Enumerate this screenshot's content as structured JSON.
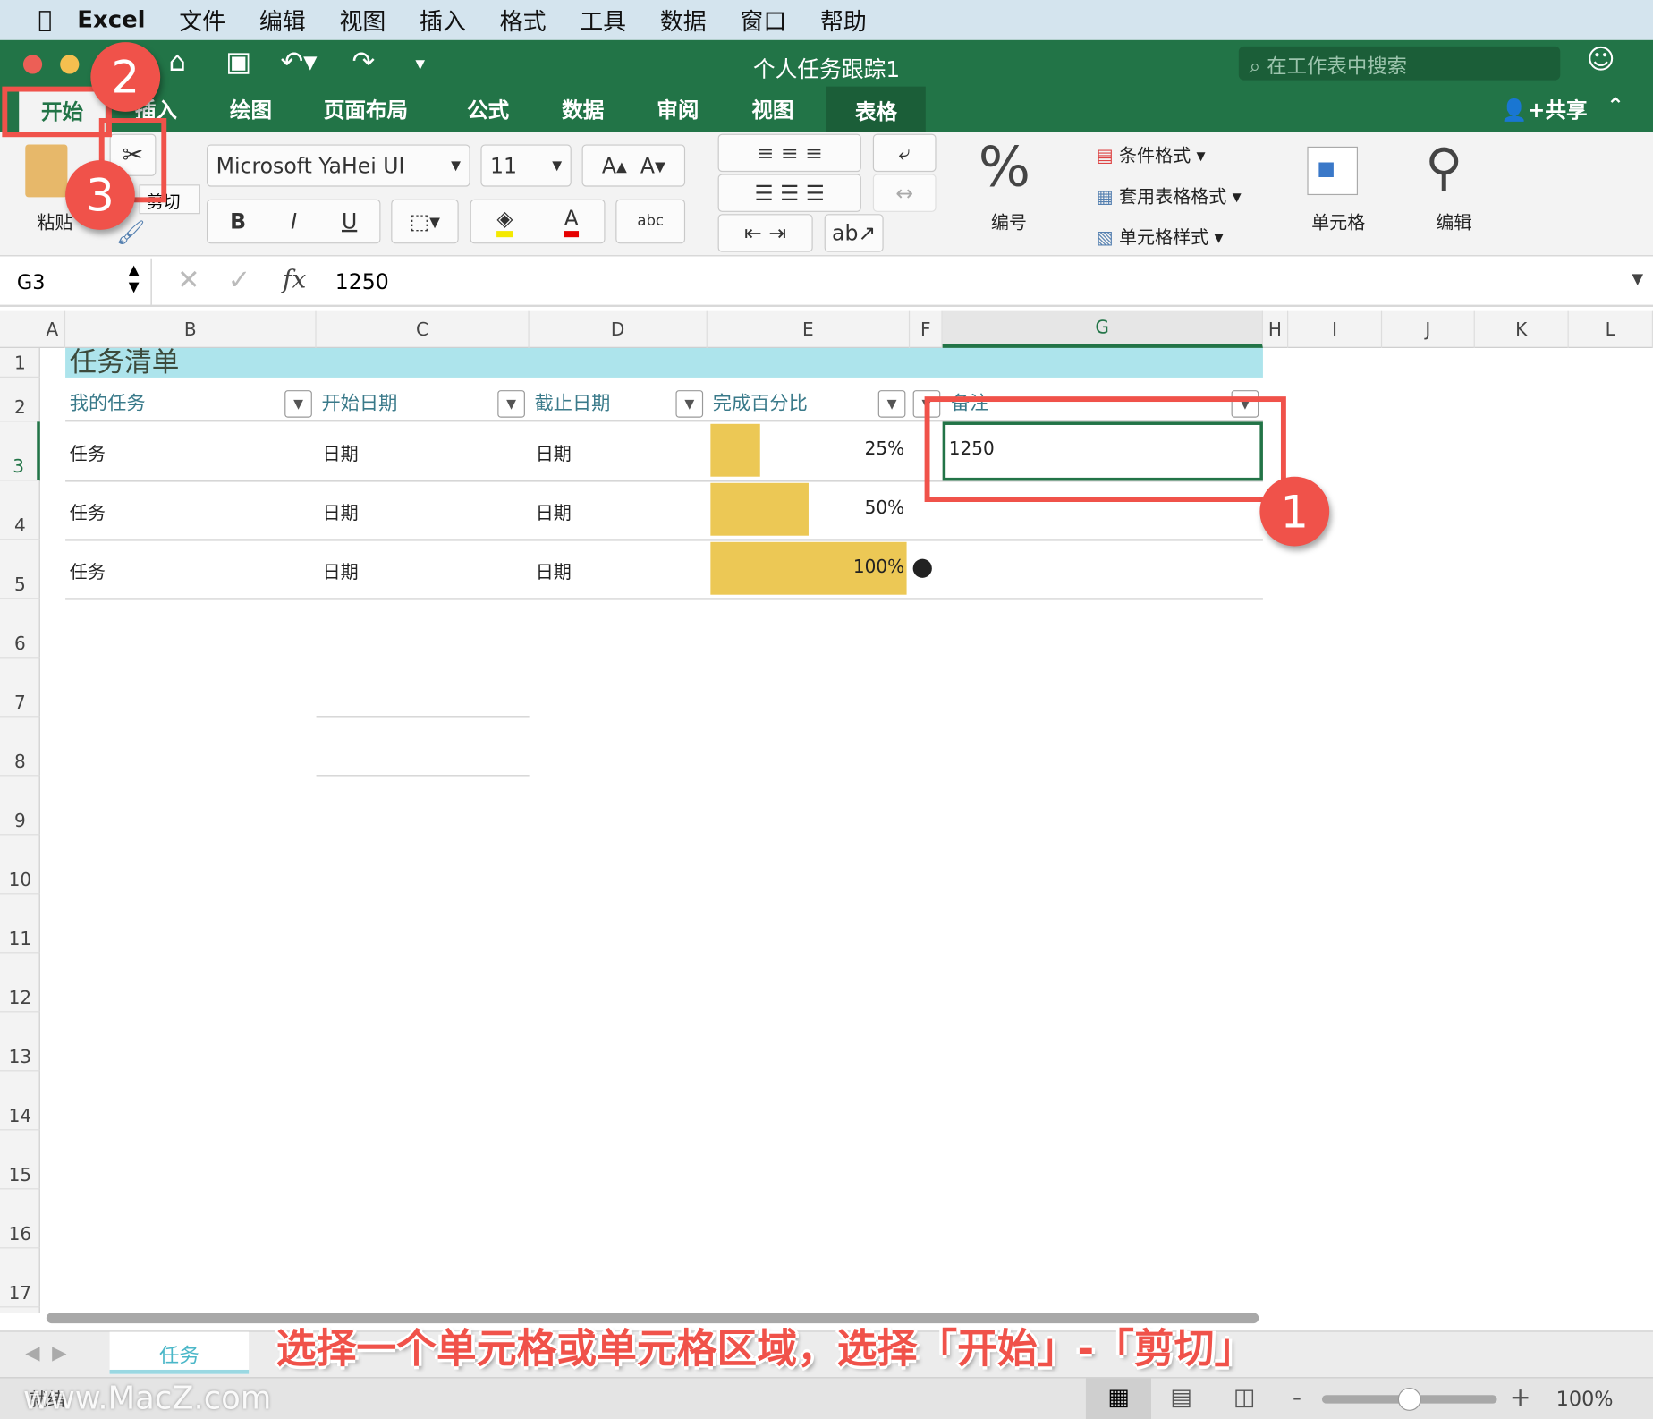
{
  "menubar": {
    "app": "Excel",
    "items": [
      "文件",
      "编辑",
      "视图",
      "插入",
      "格式",
      "工具",
      "数据",
      "窗口",
      "帮助"
    ]
  },
  "window": {
    "title": "个人任务跟踪1",
    "search_placeholder": "在工作表中搜索",
    "share": "共享"
  },
  "tabs": [
    "开始",
    "插入",
    "绘图",
    "页面布局",
    "公式",
    "数据",
    "审阅",
    "视图",
    "表格"
  ],
  "ribbon": {
    "paste": "粘贴",
    "cut_tooltip": "剪切",
    "font": "Microsoft YaHei UI",
    "size": "11",
    "bold": "B",
    "italic": "I",
    "underline": "U",
    "number": "编号",
    "cond_format": "条件格式",
    "table_format": "套用表格格式",
    "cell_styles": "单元格样式",
    "cells": "单元格",
    "edit": "编辑"
  },
  "formula_bar": {
    "name_box": "G3",
    "fx": "fx",
    "value": "1250"
  },
  "columns": [
    "A",
    "B",
    "C",
    "D",
    "E",
    "F",
    "G",
    "H",
    "I",
    "J",
    "K",
    "L"
  ],
  "rows": [
    "1",
    "2",
    "3",
    "4",
    "5",
    "6",
    "7",
    "8",
    "9",
    "10",
    "11",
    "12",
    "13",
    "14",
    "15",
    "16",
    "17"
  ],
  "sheet": {
    "title": "任务清单",
    "headers": [
      "我的任务",
      "开始日期",
      "截止日期",
      "完成百分比",
      "备注"
    ],
    "data": [
      {
        "task": "任务",
        "start": "日期",
        "end": "日期",
        "pct": "25%",
        "pct_value": 25,
        "note": "1250"
      },
      {
        "task": "任务",
        "start": "日期",
        "end": "日期",
        "pct": "50%",
        "pct_value": 50,
        "note": ""
      },
      {
        "task": "任务",
        "start": "日期",
        "end": "日期",
        "pct": "100%",
        "pct_value": 100,
        "note": ""
      }
    ]
  },
  "sheet_tab": "任务",
  "status": {
    "ready": "就绪",
    "zoom": "100%",
    "zoom_fraction": 0.5,
    "watermark": "www.MacZ.com"
  },
  "annotations": {
    "n1": "1",
    "n2": "2",
    "n3": "3",
    "caption": "选择一个单元格或单元格区域，选择「开始」-「剪切」"
  },
  "colors": {
    "excel_green": "#227447",
    "annotation_red": "#f0524a",
    "bar": "#ecc855",
    "title_band": "#ade4ec"
  }
}
